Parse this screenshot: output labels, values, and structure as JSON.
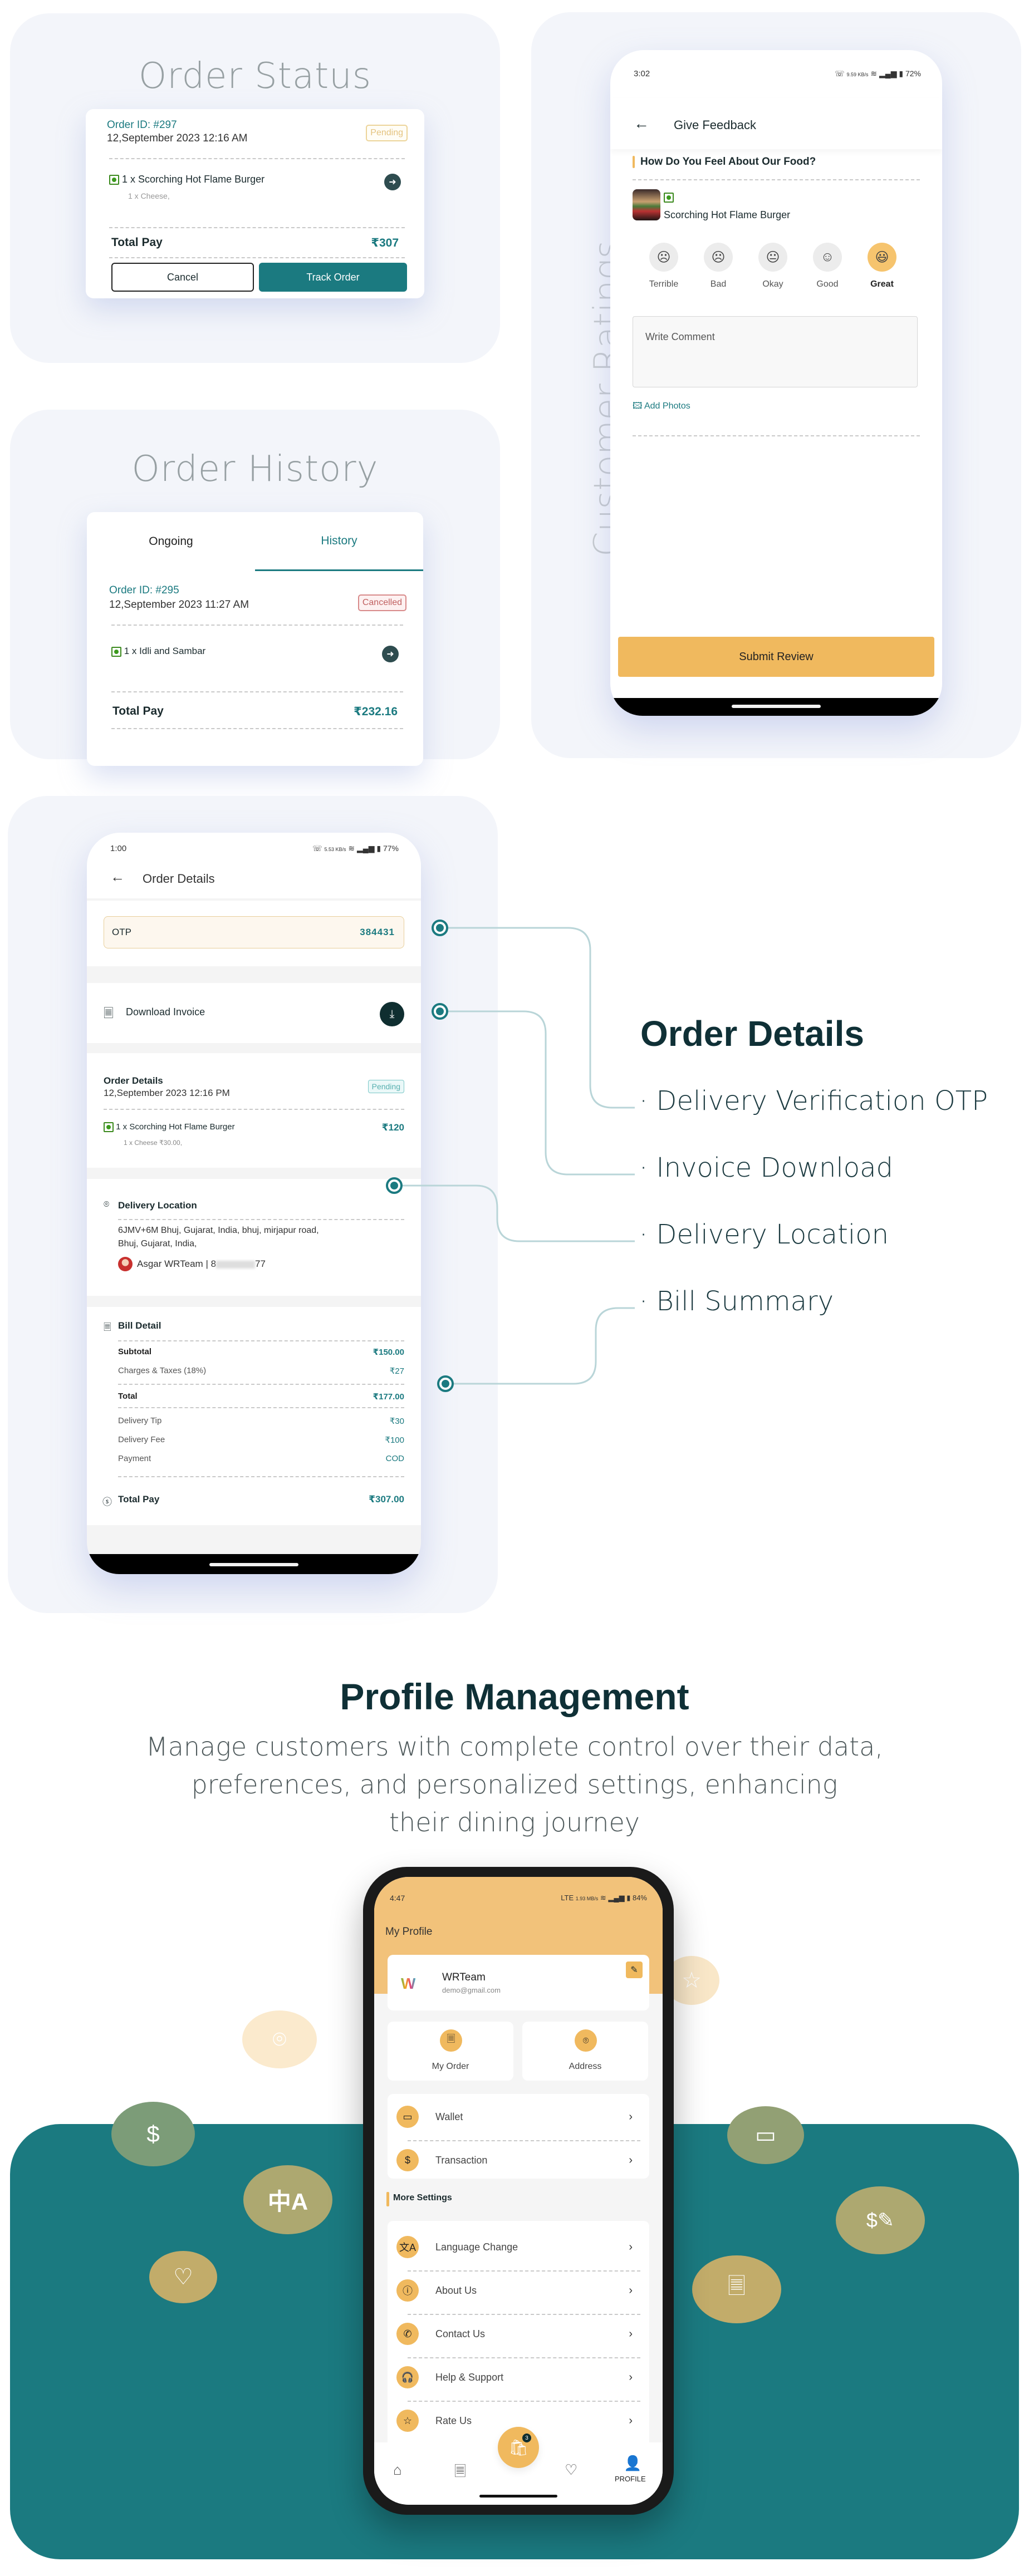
{
  "order_status": {
    "section_title": "Order Status",
    "order_id": "Order ID: #297",
    "datetime": "12,September 2023 12:16 AM",
    "status_badge": "Pending",
    "item": "1 x Scorching Hot Flame Burger",
    "addon": "1 x Cheese,",
    "total_label": "Total Pay",
    "total_value": "₹307",
    "cancel_label": "Cancel",
    "track_label": "Track Order"
  },
  "order_history": {
    "section_title": "Order History",
    "tabs": [
      {
        "label": "Ongoing",
        "active": false
      },
      {
        "label": "History",
        "active": true
      }
    ],
    "order_id": "Order ID: #295",
    "datetime": "12,September 2023 11:27 AM",
    "status_badge": "Cancelled",
    "item": "1 x Idli and Sambar",
    "total_label": "Total Pay",
    "total_value": "₹232.16"
  },
  "customer_ratings": {
    "section_title": "Customer Ratings",
    "status": {
      "time": "3:02",
      "speed": "9.59 KB/s",
      "battery": "72%"
    },
    "header_title": "Give Feedback",
    "question": "How Do You Feel About Our Food?",
    "food_name": "Scorching Hot Flame Burger",
    "ratings": [
      {
        "label": "Terrible",
        "face": "terrible-face-icon",
        "selected": false
      },
      {
        "label": "Bad",
        "face": "bad-face-icon",
        "selected": false
      },
      {
        "label": "Okay",
        "face": "okay-face-icon",
        "selected": false
      },
      {
        "label": "Good",
        "face": "good-face-icon",
        "selected": false
      },
      {
        "label": "Great",
        "face": "great-face-icon",
        "selected": true
      }
    ],
    "comment_placeholder": "Write Comment",
    "add_photos_label": "Add Photos",
    "submit_label": "Submit Review"
  },
  "order_details": {
    "status": {
      "time": "1:00",
      "speed": "5.53 KB/s",
      "battery": "77%"
    },
    "header_title": "Order Details",
    "otp_label": "OTP",
    "otp_value": "384431",
    "invoice_label": "Download Invoice",
    "details_title": "Order Details",
    "datetime": "12,September 2023 12:16 PM",
    "status_badge": "Pending",
    "item": "1 x Scorching Hot Flame Burger",
    "item_price": "₹120",
    "addon": "1 x Cheese ₹30.00,",
    "location_title": "Delivery Location",
    "address_line1": "6JMV+6M Bhuj, Gujarat, India, bhuj, mirjapur road,",
    "address_line2": "Bhuj, Gujarat, India,",
    "contact": "Asgar WRTeam | 8",
    "contact_suffix": "77",
    "bill_title": "Bill Detail",
    "bill_rows": [
      {
        "label": "Subtotal",
        "value": "₹150.00",
        "bold": true
      },
      {
        "label": "Charges & Taxes (18%)",
        "value": "₹27",
        "bold": false
      },
      {
        "label": "Total",
        "value": "₹177.00",
        "bold": true
      },
      {
        "label": "Delivery Tip",
        "value": "₹30",
        "bold": false
      },
      {
        "label": "Delivery Fee",
        "value": "₹100",
        "bold": false
      },
      {
        "label": "Payment",
        "value": "COD",
        "bold": false
      }
    ],
    "total_pay_label": "Total Pay",
    "total_pay_value": "₹307.00",
    "feature_heading": "Order Details",
    "features": [
      "Delivery Verification OTP",
      "Invoice Download",
      "Delivery Location",
      "Bill Summary"
    ]
  },
  "profile": {
    "heading": "Profile Management",
    "description_lines": [
      "Manage customers with complete control over their data,",
      "preferences, and personalized settings, enhancing",
      "their dining journey"
    ],
    "status": {
      "time": "4:47",
      "speed": "1.93 MB/s",
      "battery": "84%"
    },
    "title": "My Profile",
    "user_name": "WRTeam",
    "user_email": "demo@gmail.com",
    "quick": [
      {
        "label": "My Order",
        "icon": "receipt-icon"
      },
      {
        "label": "Address",
        "icon": "location-pin-icon"
      }
    ],
    "list1": [
      {
        "label": "Wallet",
        "icon": "wallet-icon"
      },
      {
        "label": "Transaction",
        "icon": "transaction-icon"
      }
    ],
    "more_settings_label": "More Settings",
    "list2": [
      {
        "label": "Language Change",
        "icon": "translate-icon"
      },
      {
        "label": "About Us",
        "icon": "info-icon"
      },
      {
        "label": "Contact Us",
        "icon": "phone-icon"
      },
      {
        "label": "Help & Support",
        "icon": "headphones-icon"
      },
      {
        "label": "Rate Us",
        "icon": "star-icon"
      }
    ],
    "cart_badge": "3",
    "nav": [
      {
        "label": "",
        "icon": "home-icon"
      },
      {
        "label": "",
        "icon": "orders-icon"
      },
      {
        "label": "",
        "icon": "favorites-icon"
      },
      {
        "label": "PROFILE",
        "icon": "profile-icon",
        "active": true
      }
    ]
  },
  "colors": {
    "teal": "#1b7a80",
    "gold": "#f0b95e",
    "panel": "#f3f5fa",
    "dark": "#1b3a40"
  }
}
